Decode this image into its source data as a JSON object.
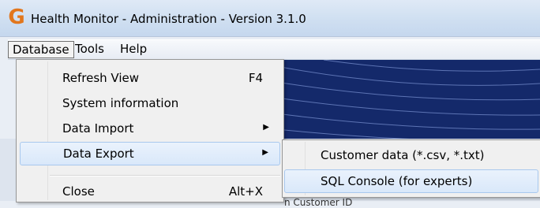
{
  "window": {
    "app_icon_glyph": "G",
    "title": "Health Monitor - Administration - Version 3.1.0"
  },
  "menubar": {
    "items": [
      {
        "label": "Database"
      },
      {
        "label": "Tools"
      },
      {
        "label": "Help"
      }
    ]
  },
  "database_menu": {
    "items": [
      {
        "label": "Refresh View",
        "shortcut": "F4"
      },
      {
        "label": "System information",
        "shortcut": ""
      },
      {
        "label": "Data Import",
        "submenu_arrow": "▶"
      },
      {
        "label": "Data Export",
        "submenu_arrow": "▶"
      },
      {
        "label": "Close",
        "shortcut": "Alt+X"
      }
    ]
  },
  "export_submenu": {
    "items": [
      {
        "label": "Customer data (*.csv, *.txt)"
      },
      {
        "label": "SQL Console (for experts)"
      }
    ]
  },
  "background": {
    "partial_text": "n   Customer ID"
  },
  "colors": {
    "navy_background": "#14296a",
    "highlight_border": "#a8c8ee",
    "app_icon": "#e2761c"
  }
}
